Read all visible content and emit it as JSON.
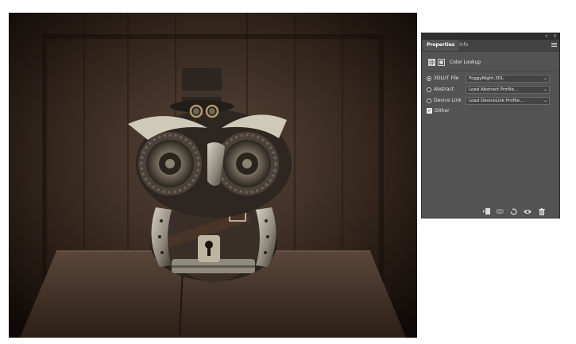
{
  "panel": {
    "tabs": [
      {
        "label": "Properties",
        "active": true
      },
      {
        "label": "Info",
        "active": false
      }
    ],
    "collapse_glyph": "»",
    "close_glyph": "×",
    "menu_icon": "hamburger-menu-icon",
    "adjustment_title": "Color Lookup",
    "options": [
      {
        "label": "3DLUT File",
        "selected": true,
        "value": "FoggyNight.3DL"
      },
      {
        "label": "Abstract",
        "selected": false,
        "value": "Load Abstract Profile..."
      },
      {
        "label": "Device Link",
        "selected": false,
        "value": "Load DeviceLink Profile..."
      }
    ],
    "dither_label": "Dither",
    "dither_checked": true,
    "checkmark": "✓",
    "footer_icons": [
      "clip-to-layer-icon",
      "view-previous-state-icon",
      "reset-icon",
      "visibility-eye-icon",
      "trash-icon"
    ]
  },
  "colors": {
    "panel_bg": "#535353",
    "tab_bar": "#424242",
    "canvas_bg": "#1a120d"
  }
}
